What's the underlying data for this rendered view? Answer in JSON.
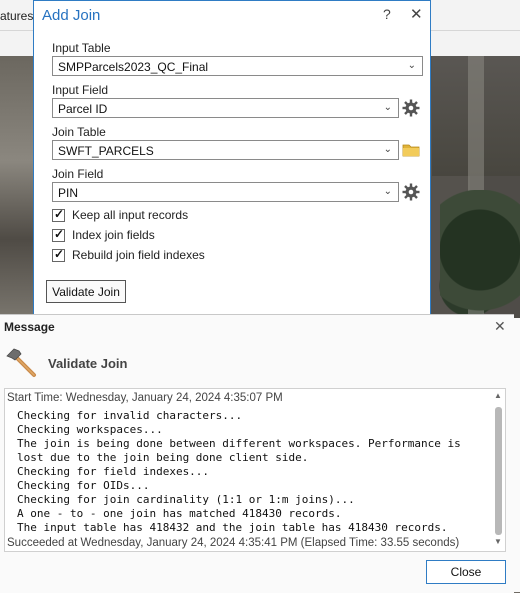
{
  "background": {
    "tab_partial": "atures"
  },
  "add_join": {
    "title": "Add Join",
    "help_glyph": "?",
    "close_glyph": "✕",
    "input_table": {
      "label": "Input Table",
      "value": "SMPParcels2023_QC_Final"
    },
    "input_field": {
      "label": "Input Field",
      "value": "Parcel ID",
      "icon": "gear-icon"
    },
    "join_table": {
      "label": "Join Table",
      "value": "SWFT_PARCELS",
      "icon": "folder-icon"
    },
    "join_field": {
      "label": "Join Field",
      "value": "PIN",
      "icon": "gear-icon"
    },
    "options": [
      {
        "label": "Keep all input records",
        "checked": true
      },
      {
        "label": "Index join fields",
        "checked": true
      },
      {
        "label": "Rebuild join field indexes",
        "checked": true
      }
    ],
    "validate_button": "Validate Join"
  },
  "message": {
    "title": "Message",
    "close_glyph": "✕",
    "tool_name": "Validate Join",
    "start_time": "Start Time: Wednesday, January 24, 2024 4:35:07 PM",
    "lines": [
      "Checking for invalid characters...",
      "Checking workspaces...",
      "The join is being done between different workspaces. Performance is",
      "lost due to the join being done client side.",
      "Checking for field indexes...",
      "Checking for OIDs...",
      "Checking for join cardinality (1:1 or 1:m joins)...",
      "A one - to - one join has matched 418430 records.",
      "The input table has 418432 and the join table has 418430 records."
    ],
    "succeeded": "Succeeded at Wednesday, January 24, 2024 4:35:41 PM (Elapsed Time: 33.55 seconds)",
    "close_button": "Close"
  },
  "colors": {
    "accent": "#2672c0",
    "dialog_border": "#2f7cc4"
  }
}
